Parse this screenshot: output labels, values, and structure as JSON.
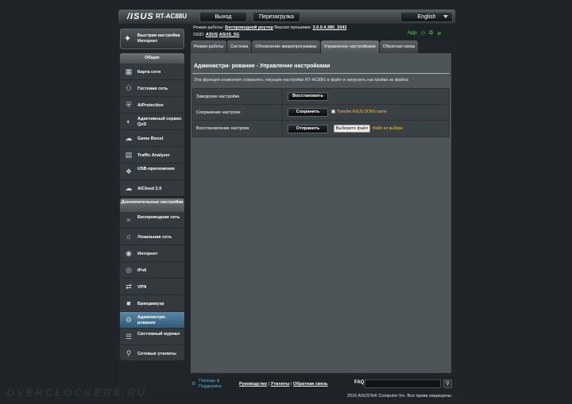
{
  "header": {
    "logo": "/ISUS",
    "model": "RT-AC88U",
    "logout_label": "Выход",
    "reboot_label": "Перезагрузка",
    "language": "English"
  },
  "info": {
    "mode_label": "Режим работы:",
    "mode_value": "Беспроводной роутер",
    "firmware_label": "Версия прошивки:",
    "firmware_value": "3.0.0.4.380_3343",
    "ssid_label": "SSID:",
    "ssid_1": "ASUS",
    "ssid_2": "ASUS_5G",
    "app_label": "App",
    "status_icons": [
      "user-icon",
      "network-icon",
      "usb-icon"
    ]
  },
  "sidebar": {
    "quick_setup": "Быстрая настройка Интернет",
    "general_title": "Общие",
    "general_items": [
      {
        "label": "Карта сети",
        "icon": "network-map-icon"
      },
      {
        "label": "Гостевая сеть",
        "icon": "guest-network-icon"
      },
      {
        "label": "AiProtection",
        "icon": "shield-icon"
      },
      {
        "label": "Адаптивный сервис QoS",
        "icon": "qos-icon"
      },
      {
        "label": "Game Boost",
        "icon": "gamepad-icon"
      },
      {
        "label": "Traffic Analyzer",
        "icon": "traffic-analyzer-icon"
      },
      {
        "label": "USB-приложение",
        "icon": "usb-app-icon"
      },
      {
        "label": "AiCloud 2.0",
        "icon": "cloud-icon"
      }
    ],
    "advanced_title": "Дополнительные настройки",
    "advanced_items": [
      {
        "label": "Беспроводная сеть",
        "icon": "wifi-icon"
      },
      {
        "label": "Локальная сеть",
        "icon": "home-icon"
      },
      {
        "label": "Интернет",
        "icon": "globe-icon"
      },
      {
        "label": "IPv6",
        "icon": "ipv6-icon"
      },
      {
        "label": "VPN",
        "icon": "vpn-icon"
      },
      {
        "label": "Брандмауэр",
        "icon": "firewall-icon"
      },
      {
        "label": "Администри- рование",
        "icon": "admin-icon"
      },
      {
        "label": "Системный журнал",
        "icon": "syslog-icon"
      },
      {
        "label": "Сетевые утилиты",
        "icon": "network-tools-icon"
      }
    ]
  },
  "tabs": [
    {
      "label": "Режим работы"
    },
    {
      "label": "Система"
    },
    {
      "label": "Обновление микропрограммы"
    },
    {
      "label": "Управление настройками"
    },
    {
      "label": "Обратная связь"
    }
  ],
  "main": {
    "title": "Администри- рование - Управление настройками",
    "description": "Эта функция позволяет сохранять текущие настройки RT-AC88U в файл и загрузить настройки из файла",
    "rows": [
      {
        "label": "Заводские настройки",
        "button": "Восстановить"
      },
      {
        "label": "Сохранение настроек",
        "button": "Сохранить",
        "checkbox_label": "Transfer ASUS DDNS name"
      },
      {
        "label": "Восстановление настроек",
        "button": "Отправить",
        "file_button": "Выберите файл",
        "file_status": "Файл не выбран"
      }
    ]
  },
  "footer": {
    "help": "Помощь & Поддержка",
    "link_manual": "Руководство",
    "sep": "|",
    "link_utils": "Утилиты",
    "link_feedback": "Обратная связь",
    "faq": "FAQ",
    "copyright": "2016 ASUSTeK Computer Inc. Все права защищены."
  },
  "watermark": "OVERCLOCKERS.RU"
}
